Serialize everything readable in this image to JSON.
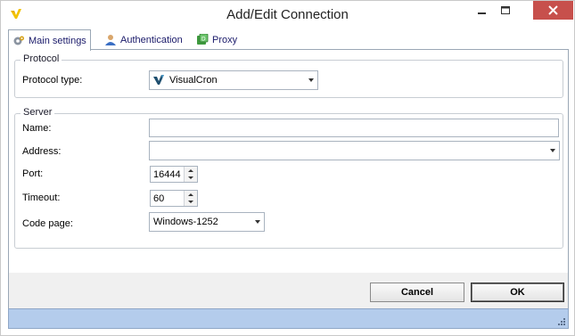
{
  "window": {
    "title": "Add/Edit Connection"
  },
  "tabs": [
    {
      "label": "Main settings",
      "icon": "gear-icon",
      "active": true
    },
    {
      "label": "Authentication",
      "icon": "user-icon",
      "active": false
    },
    {
      "label": "Proxy",
      "icon": "proxy-icon",
      "active": false
    }
  ],
  "protocol": {
    "legend": "Protocol",
    "type_label": "Protocol type:",
    "type_value": "VisualCron"
  },
  "server": {
    "legend": "Server",
    "name_label": "Name:",
    "name_value": "",
    "address_label": "Address:",
    "address_value": "",
    "port_label": "Port:",
    "port_value": "16444",
    "timeout_label": "Timeout:",
    "timeout_value": "60",
    "codepage_label": "Code page:",
    "codepage_value": "Windows-1252"
  },
  "buttons": {
    "cancel": "Cancel",
    "ok": "OK"
  },
  "colors": {
    "accent": "#b4ccec",
    "close": "#c7504c",
    "brand": "#f2c200"
  }
}
